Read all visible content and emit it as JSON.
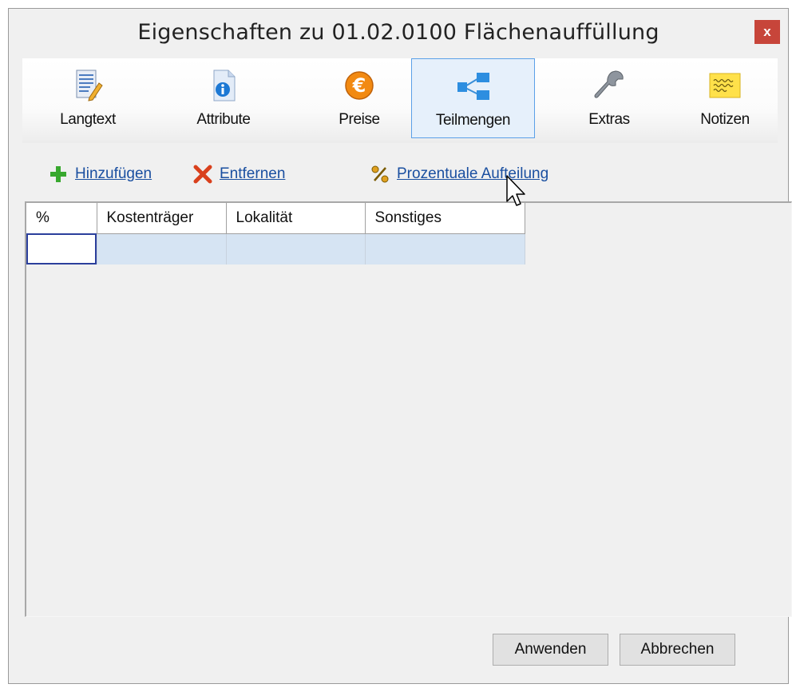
{
  "window": {
    "title": "Eigenschaften zu 01.02.0100 Flächenauffüllung",
    "close_label": "x"
  },
  "tabs": [
    {
      "label": "Langtext",
      "icon": "langtext-icon",
      "active": false
    },
    {
      "label": "Attribute",
      "icon": "attribute-icon",
      "active": false
    },
    {
      "label": "Preise",
      "icon": "euro-icon",
      "active": false
    },
    {
      "label": "Teilmengen",
      "icon": "split-icon",
      "active": true
    },
    {
      "label": "Extras",
      "icon": "wrench-icon",
      "active": false
    },
    {
      "label": "Notizen",
      "icon": "notes-icon",
      "active": false
    }
  ],
  "actions": {
    "add_label": "Hinzufügen",
    "remove_label": "Entfernen",
    "percent_label": "Prozentuale Aufteilung"
  },
  "grid": {
    "columns": [
      "%",
      "Kostenträger",
      "Lokalität",
      "Sonstiges"
    ],
    "rows": [
      [
        "",
        "",
        "",
        ""
      ]
    ]
  },
  "buttons": {
    "apply_label": "Anwenden",
    "cancel_label": "Abbrechen"
  },
  "colors": {
    "accent": "#5ba0e8",
    "link": "#1a4fa0",
    "close": "#c7453a",
    "row_fill": "#d6e4f3"
  }
}
